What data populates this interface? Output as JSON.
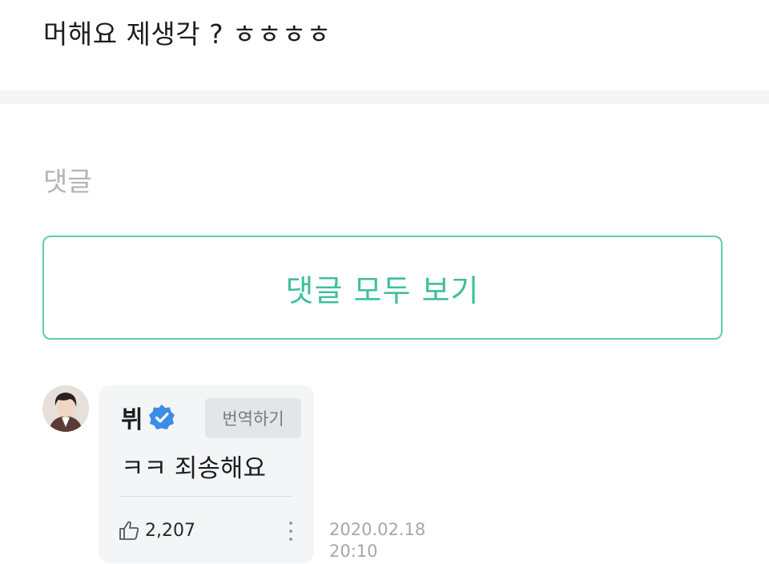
{
  "post": {
    "text": "머해요 제생각 ? ㅎㅎㅎㅎ"
  },
  "comments_section": {
    "title": "댓글",
    "view_all_label": "댓글 모두 보기"
  },
  "comment": {
    "author": "뷔",
    "verified_icon": "verified-badge-icon",
    "translate_label": "번역하기",
    "text": "ㅋㅋ 죄송해요",
    "likes": "2,207",
    "date": "2020.02.18",
    "time": "20:10"
  },
  "colors": {
    "accent": "#3fbf9b",
    "verified": "#3b8de8"
  }
}
